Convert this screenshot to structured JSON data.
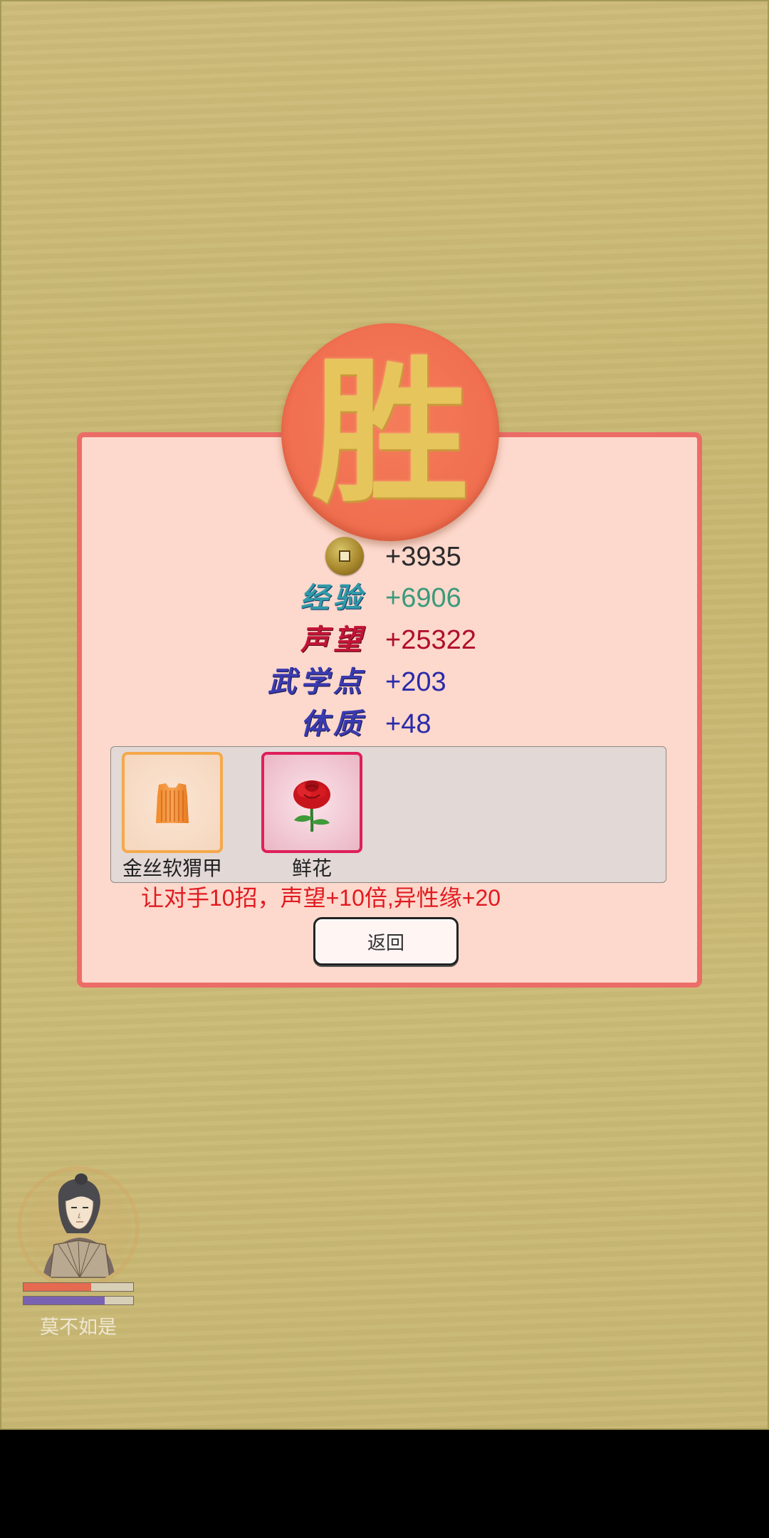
{
  "victory": {
    "seal_char": "胜"
  },
  "rewards": {
    "coin": {
      "icon": "copper-coin-icon",
      "value": "+3935",
      "color": "#2a2a2a"
    },
    "exp": {
      "label": "经验",
      "value": "+6906",
      "label_color": "#2f9aa8",
      "value_color": "#3a9a7a"
    },
    "fame": {
      "label": "声望",
      "value": "+25322",
      "label_color": "#c21436",
      "value_color": "#b0102a"
    },
    "skill_points": {
      "label": "武学点",
      "value": "+203",
      "label_color": "#3a3ab0",
      "value_color": "#2a2aaa"
    },
    "constitution": {
      "label": "体质",
      "value": "+48",
      "label_color": "#3a3ab0",
      "value_color": "#2a2aaa"
    }
  },
  "items": [
    {
      "name": "金丝软猬甲",
      "icon": "golden-armor-icon",
      "rarity_color": "#f5a94a"
    },
    {
      "name": "鲜花",
      "icon": "rose-flower-icon",
      "rarity_color": "#de1f5a"
    }
  ],
  "bonus_text": "让对手10招，声望+10倍,异性缘+20",
  "return_label": "返回",
  "player": {
    "name": "莫不如是",
    "hp_fraction": 0.62,
    "mp_fraction": 0.74,
    "hp_color": "#e56a50",
    "mp_color": "#7a62b2"
  }
}
